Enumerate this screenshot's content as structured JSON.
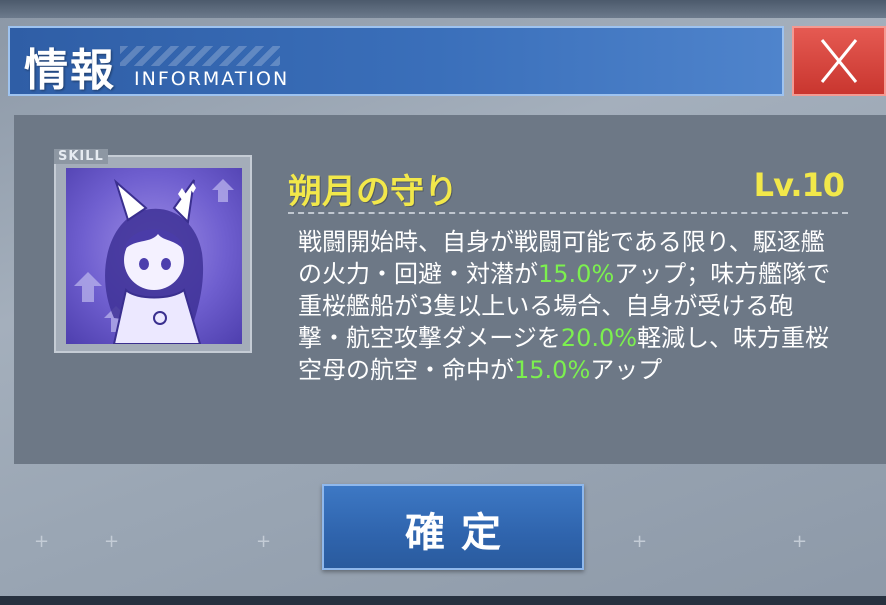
{
  "header": {
    "title_jp": "情報",
    "title_en": "INFORMATION",
    "close_icon": "close-x-icon"
  },
  "skill": {
    "tag": "SKILL",
    "icon": "fox-girl-shield-skill-icon",
    "name": "朔月の守り",
    "level": "Lv.10",
    "description": {
      "part1": "戦闘開始時、自身が戦闘可能である限り、駆逐艦の火力・回避・対潜が",
      "value1": "15.0%",
      "part2": "アップ；味方艦隊で重桜艦船が3隻以上いる場合、自身が受ける砲撃・航空攻撃ダメージを",
      "value2": "20.0%",
      "part3": "軽減し、味方重桜空母の航空・命中が",
      "value3": "15.0%",
      "part4": "アップ"
    }
  },
  "buttons": {
    "confirm": "確定"
  },
  "colors": {
    "header_blue": "#3a6fba",
    "close_red": "#d6443c",
    "skill_name_yellow": "#f2e84a",
    "highlight_green": "#7cf04f",
    "panel_gray": "#6d7886"
  }
}
